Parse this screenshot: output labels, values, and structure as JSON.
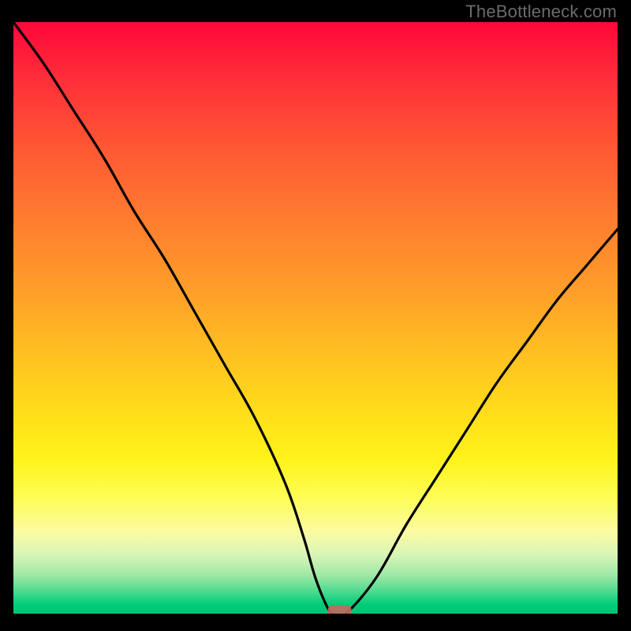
{
  "watermark": "TheBottleneck.com",
  "chart_data": {
    "type": "line",
    "title": "",
    "xlabel": "",
    "ylabel": "",
    "xlim": [
      0,
      100
    ],
    "ylim": [
      0,
      100
    ],
    "x": [
      0,
      5,
      10,
      15,
      20,
      25,
      30,
      35,
      40,
      45,
      48,
      50,
      52,
      53,
      55,
      60,
      65,
      70,
      75,
      80,
      85,
      90,
      95,
      100
    ],
    "values": [
      100,
      93,
      85,
      77,
      68,
      60,
      51,
      42,
      33,
      22,
      13,
      6,
      1,
      0,
      0,
      6,
      15,
      23,
      31,
      39,
      46,
      53,
      59,
      65
    ],
    "marker": {
      "x": 54,
      "y": 0
    },
    "gradient_bands": [
      {
        "color": "#ff073a",
        "stop": 0.0
      },
      {
        "color": "#ff2f3a",
        "stop": 0.1
      },
      {
        "color": "#ff5a33",
        "stop": 0.22
      },
      {
        "color": "#ff7e2f",
        "stop": 0.34
      },
      {
        "color": "#ffa029",
        "stop": 0.46
      },
      {
        "color": "#ffc021",
        "stop": 0.56
      },
      {
        "color": "#ffdd1a",
        "stop": 0.66
      },
      {
        "color": "#fff31a",
        "stop": 0.74
      },
      {
        "color": "#fdfd52",
        "stop": 0.8
      },
      {
        "color": "#fcfca0",
        "stop": 0.86
      },
      {
        "color": "#d9f5b8",
        "stop": 0.9
      },
      {
        "color": "#9fe8a6",
        "stop": 0.935
      },
      {
        "color": "#45d98c",
        "stop": 0.965
      },
      {
        "color": "#00cc7a",
        "stop": 0.985
      },
      {
        "color": "#00c472",
        "stop": 1.0
      }
    ]
  }
}
